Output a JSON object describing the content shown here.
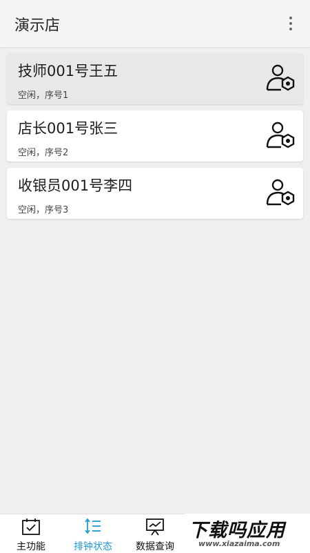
{
  "header": {
    "title": "演示店",
    "more_icon": "more-vertical-icon"
  },
  "staff": [
    {
      "name": "技师001号王五",
      "status": "空闲，序号1",
      "icon": "user-settings-icon"
    },
    {
      "name": "店长001号张三",
      "status": "空闲，序号2",
      "icon": "user-settings-icon"
    },
    {
      "name": "收银员001号李四",
      "status": "空闲，序号3",
      "icon": "user-settings-icon"
    }
  ],
  "nav": {
    "items": [
      {
        "label": "主功能",
        "icon": "calendar-check-icon"
      },
      {
        "label": "排钟状态",
        "icon": "sort-list-icon"
      },
      {
        "label": "数据查询",
        "icon": "presentation-chart-icon"
      }
    ],
    "active_color": "#1e9bd7"
  },
  "watermark": {
    "main": "下载吗应用",
    "sub": "www.xiazaima.com"
  }
}
